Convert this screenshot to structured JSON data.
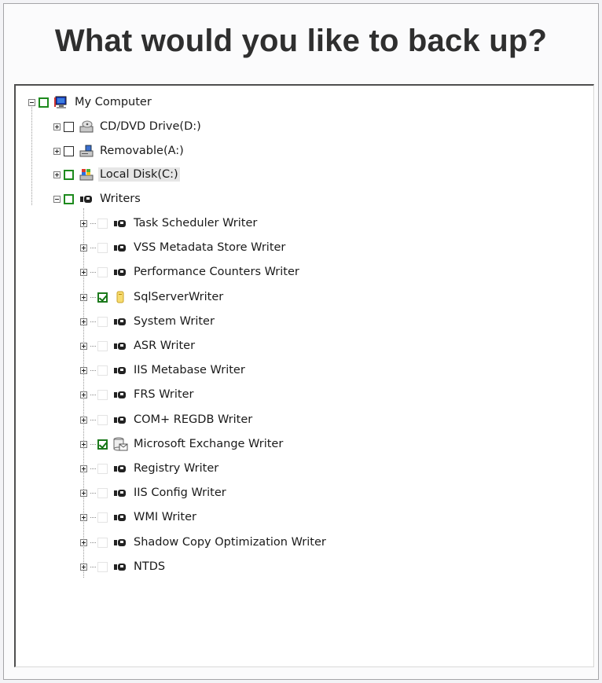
{
  "title": "What would you like to back up?",
  "tree": {
    "root": {
      "label": "My Computer",
      "icon": "computer-icon"
    },
    "drives": [
      {
        "label": "CD/DVD Drive(D:)",
        "icon": "cd-drive-icon"
      },
      {
        "label": "Removable(A:)",
        "icon": "removable-drive-icon"
      },
      {
        "label": "Local Disk(C:)",
        "icon": "local-disk-icon",
        "selected": true
      }
    ],
    "writers_group": {
      "label": "Writers",
      "icon": "writer-icon"
    },
    "writers": [
      {
        "label": "Task Scheduler Writer",
        "checked": false,
        "icon": "writer-icon"
      },
      {
        "label": "VSS Metadata Store Writer",
        "checked": false,
        "icon": "writer-icon"
      },
      {
        "label": "Performance Counters Writer",
        "checked": false,
        "icon": "writer-icon"
      },
      {
        "label": "SqlServerWriter",
        "checked": true,
        "icon": "sql-server-icon"
      },
      {
        "label": "System Writer",
        "checked": false,
        "icon": "writer-icon"
      },
      {
        "label": "ASR Writer",
        "checked": false,
        "icon": "writer-icon"
      },
      {
        "label": "IIS Metabase Writer",
        "checked": false,
        "icon": "writer-icon"
      },
      {
        "label": "FRS Writer",
        "checked": false,
        "icon": "writer-icon"
      },
      {
        "label": "COM+ REGDB Writer",
        "checked": false,
        "icon": "writer-icon"
      },
      {
        "label": "Microsoft Exchange Writer",
        "checked": true,
        "icon": "exchange-icon"
      },
      {
        "label": "Registry Writer",
        "checked": false,
        "icon": "writer-icon"
      },
      {
        "label": "IIS Config Writer",
        "checked": false,
        "icon": "writer-icon"
      },
      {
        "label": "WMI Writer",
        "checked": false,
        "icon": "writer-icon"
      },
      {
        "label": "Shadow Copy Optimization Writer",
        "checked": false,
        "icon": "writer-icon"
      },
      {
        "label": "NTDS",
        "checked": false,
        "icon": "writer-icon"
      }
    ]
  },
  "colors": {
    "check_green": "#1d8a1d",
    "selection": "#e6e6e6"
  }
}
